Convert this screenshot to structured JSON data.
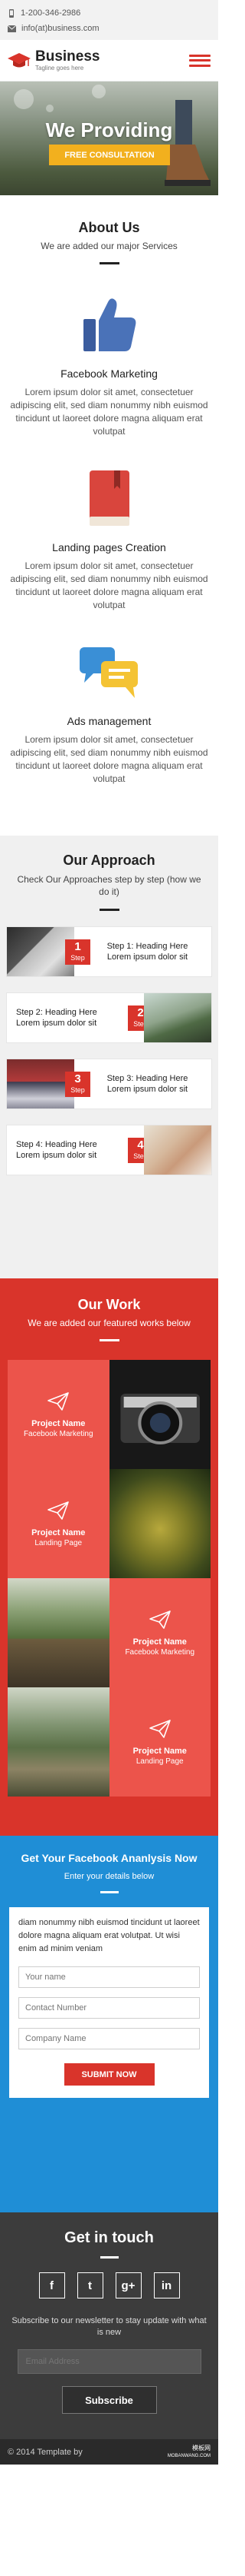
{
  "topbar": {
    "phone": "1-200-346-2986",
    "email": "info(at)business.com"
  },
  "header": {
    "brand": "Business",
    "tagline": "Tagline goes here"
  },
  "hero": {
    "title": "We Providing",
    "button": "FREE CONSULTATION"
  },
  "about": {
    "title": "About Us",
    "subtitle": "We are added our major Services",
    "services": [
      {
        "icon": "thumbs-up-icon",
        "title": "Facebook Marketing",
        "text": "Lorem ipsum dolor sit amet, consectetuer adipiscing elit, sed diam nonummy nibh euismod tincidunt ut laoreet dolore magna aliquam erat volutpat"
      },
      {
        "icon": "book-icon",
        "title": "Landing pages Creation",
        "text": "Lorem ipsum dolor sit amet, consectetuer adipiscing elit, sed diam nonummy nibh euismod tincidunt ut laoreet dolore magna aliquam erat volutpat"
      },
      {
        "icon": "chat-bubbles-icon",
        "title": "Ads management",
        "text": "Lorem ipsum dolor sit amet, consectetuer adipiscing elit, sed diam nonummy nibh euismod tincidunt ut laoreet dolore magna aliquam erat volutpat"
      }
    ]
  },
  "approach": {
    "title": "Our Approach",
    "subtitle": "Check Our Approaches step by step (how we do it)",
    "steps": [
      {
        "num": "1",
        "step": "Step",
        "heading": "Step 1: Heading Here",
        "text": "Lorem ipsum dolor sit"
      },
      {
        "num": "2",
        "step": "Step",
        "heading": "Step 2: Heading Here",
        "text": "Lorem ipsum dolor sit"
      },
      {
        "num": "3",
        "step": "Step",
        "heading": "Step 3: Heading Here",
        "text": "Lorem ipsum dolor sit"
      },
      {
        "num": "4",
        "step": "Step",
        "heading": "Step 4: Heading Here",
        "text": "Lorem ipsum dolor sit"
      }
    ]
  },
  "work": {
    "title": "Our Work",
    "subtitle": "We are added our featured works below",
    "projects": [
      {
        "name": "Project Name",
        "category": "Facebook Marketing"
      },
      {
        "name": "Project Name",
        "category": "Landing Page"
      },
      {
        "name": "Project Name",
        "category": "Facebook Marketing"
      },
      {
        "name": "Project Name",
        "category": "Landing Page"
      }
    ]
  },
  "facebook": {
    "title": "Get Your Facebook Ananlysis Now",
    "subtitle": "Enter your details below",
    "text": "diam nonummy nibh euismod tincidunt ut laoreet dolore magna aliquam erat volutpat. Ut wisi enim ad minim veniam",
    "name_placeholder": "Your name",
    "contact_placeholder": "Contact Number",
    "company_placeholder": "Company Name",
    "submit": "SUBMIT NOW"
  },
  "footer": {
    "title": "Get in touch",
    "socials": [
      "f",
      "t",
      "g+",
      "in"
    ],
    "newsletter": "Subscribe to our newsletter to stay update with what is new",
    "email_placeholder": "Email Address",
    "subscribe": "Subscribe",
    "copyright": "© 2014 Template by",
    "watermark_line1": "模板网",
    "watermark_line2": "MOBANWANG.COM"
  },
  "colors": {
    "accent_red": "#d9342b",
    "tile_red": "#ec544b",
    "blue": "#1f8ed6",
    "yellow": "#f2b01e",
    "footer": "#3c3c3c"
  }
}
